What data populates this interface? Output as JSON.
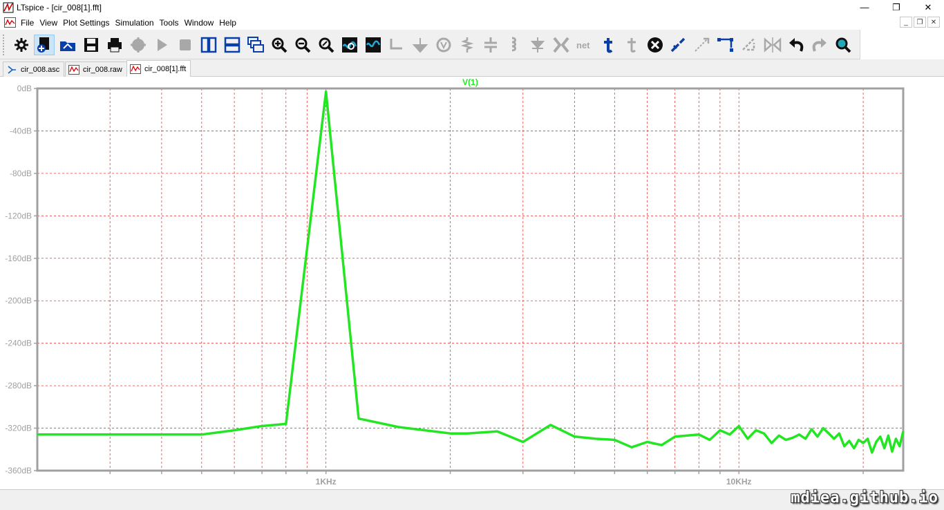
{
  "window": {
    "title": "LTspice - [cir_008[1].fft]",
    "minimize": "—",
    "restore": "❐",
    "close": "✕"
  },
  "menu": {
    "items": [
      "File",
      "View",
      "Plot Settings",
      "Simulation",
      "Tools",
      "Window",
      "Help"
    ]
  },
  "mdi": {
    "minimize": "_",
    "restore": "❐",
    "close": "✕"
  },
  "toolbar": {
    "tools": [
      "settings-icon",
      "new-schematic-icon",
      "open-icon",
      "save-icon",
      "print-icon",
      "halt-icon",
      "run-icon",
      "stop-icon",
      "tile-vertical-icon",
      "tile-horizontal-icon",
      "cascade-icon",
      "zoom-in-icon",
      "zoom-out-icon",
      "zoom-fit-icon",
      "autorange-icon",
      "waveform-icon",
      "wire-icon",
      "ground-icon",
      "label-icon",
      "resistor-icon",
      "capacitor-icon",
      "inductor-icon",
      "diode-icon",
      "component-icon",
      "net-icon",
      "text-icon",
      "spice-directive-icon",
      "delete-icon",
      "duplicate-icon",
      "move-icon",
      "drag-icon",
      "rotate-icon",
      "mirror-icon",
      "undo-icon",
      "redo-icon",
      "find-icon"
    ]
  },
  "tabs": [
    {
      "label": "cir_008.asc",
      "kind": "schematic"
    },
    {
      "label": "cir_008.raw",
      "kind": "waveform"
    },
    {
      "label": "cir_008[1].fft",
      "kind": "waveform"
    }
  ],
  "watermark": "mdiea.github.io",
  "colors": {
    "trace": "#22e622",
    "grid": "#d84040",
    "axis_text": "#a0a0a0",
    "frame": "#a0a0a0",
    "accent": "#0a64c8"
  },
  "chart_data": {
    "type": "line",
    "title": "V(1)",
    "xscale": "log",
    "xlim": [
      200,
      25000
    ],
    "ylim": [
      -360,
      0
    ],
    "y_ticks": [
      "0dB",
      "-40dB",
      "-80dB",
      "-120dB",
      "-160dB",
      "-200dB",
      "-240dB",
      "-280dB",
      "-320dB",
      "-360dB"
    ],
    "y_tick_values": [
      0,
      -40,
      -80,
      -120,
      -160,
      -200,
      -240,
      -280,
      -320,
      -360
    ],
    "x_ticks": [
      "1KHz",
      "10KHz"
    ],
    "x_tick_values": [
      1000,
      10000
    ],
    "grid": true,
    "series": [
      {
        "name": "V(1)",
        "x": [
          200,
          500,
          600,
          700,
          800,
          1000,
          1200,
          1500,
          2000,
          2200,
          2600,
          3000,
          3500,
          4000,
          4500,
          5000,
          5500,
          6000,
          6500,
          7000,
          7500,
          8000,
          8500,
          9000,
          9500,
          10000,
          10500,
          11000,
          11500,
          12000,
          12500,
          13000,
          13500,
          14000,
          14500,
          15000,
          15500,
          16000,
          16500,
          17000,
          17500,
          18000,
          18500,
          19000,
          19500,
          20000,
          20500,
          21000,
          21500,
          22000,
          22500,
          23000,
          23500,
          24000,
          24500,
          25000
        ],
        "y": [
          -326,
          -326,
          -322,
          -318,
          -316,
          -3,
          -311,
          -319,
          -325,
          -325,
          -323,
          -333,
          -317,
          -328,
          -330,
          -331,
          -338,
          -333,
          -336,
          -328,
          -327,
          -326,
          -331,
          -322,
          -326,
          -318,
          -330,
          -322,
          -325,
          -334,
          -327,
          -331,
          -329,
          -326,
          -330,
          -321,
          -328,
          -320,
          -325,
          -330,
          -325,
          -337,
          -332,
          -339,
          -331,
          -334,
          -330,
          -343,
          -333,
          -328,
          -339,
          -327,
          -342,
          -330,
          -337,
          -323
        ]
      }
    ]
  }
}
